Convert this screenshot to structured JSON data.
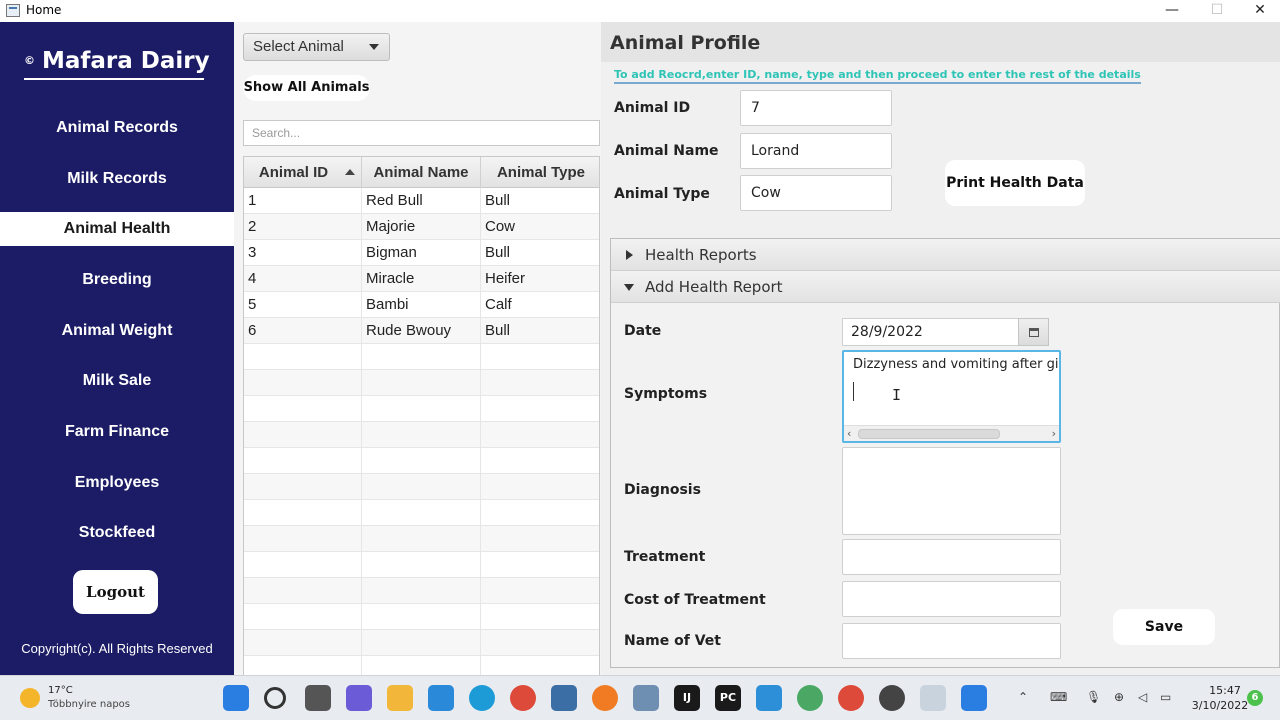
{
  "window": {
    "title": "Home",
    "minimize": "—",
    "maximize": "☐",
    "close": "✕"
  },
  "sidebar": {
    "copyright_symbol": "©",
    "brand": "Mafara Dairy",
    "items": [
      {
        "label": "Animal Records",
        "active": false
      },
      {
        "label": "Milk Records",
        "active": false
      },
      {
        "label": "Animal Health",
        "active": true
      },
      {
        "label": "Breeding",
        "active": false
      },
      {
        "label": "Animal Weight",
        "active": false
      },
      {
        "label": "Milk Sale",
        "active": false
      },
      {
        "label": "Farm Finance",
        "active": false
      },
      {
        "label": "Employees",
        "active": false
      },
      {
        "label": "Stockfeed",
        "active": false
      }
    ],
    "logout_label": "Logout",
    "copyright": "Copyright(c). All Rights Reserved"
  },
  "middle": {
    "select_label": "Select Animal",
    "show_all_label": "Show All Animals",
    "search_placeholder": "Search...",
    "columns": [
      "Animal ID",
      "Animal Name",
      "Animal Type"
    ],
    "rows": [
      [
        "1",
        "Red Bull",
        "Bull"
      ],
      [
        "2",
        "Majorie",
        "Cow"
      ],
      [
        "3",
        "Bigman",
        "Bull"
      ],
      [
        "4",
        "Miracle",
        "Heifer"
      ],
      [
        "5",
        "Bambi",
        "Calf"
      ],
      [
        "6",
        "Rude Bwouy",
        "Bull"
      ]
    ]
  },
  "profile": {
    "title": "Animal Profile",
    "hint": "To add Reocrd,enter ID, name, type and then proceed to enter the rest of the details",
    "id_label": "Animal ID",
    "id_value": "7",
    "name_label": "Animal Name",
    "name_value": "Lorand",
    "type_label": "Animal Type",
    "type_value": "Cow",
    "print_label": "Print Health Data"
  },
  "health": {
    "reports_label": "Health Reports",
    "add_label": "Add Health Report",
    "date_label": "Date",
    "date_value": "28/9/2022",
    "symptoms_label": "Symptoms",
    "symptoms_value": "Dizzyness and vomiting after giv",
    "diagnosis_label": "Diagnosis",
    "treatment_label": "Treatment",
    "cost_label": "Cost of  Treatment",
    "vet_label": "Name of Vet",
    "save_label": "Save"
  },
  "taskbar": {
    "temperature": "17°C",
    "weather": "Többnyire napos",
    "time": "15:47",
    "date": "3/10/2022",
    "notifications": "6"
  }
}
